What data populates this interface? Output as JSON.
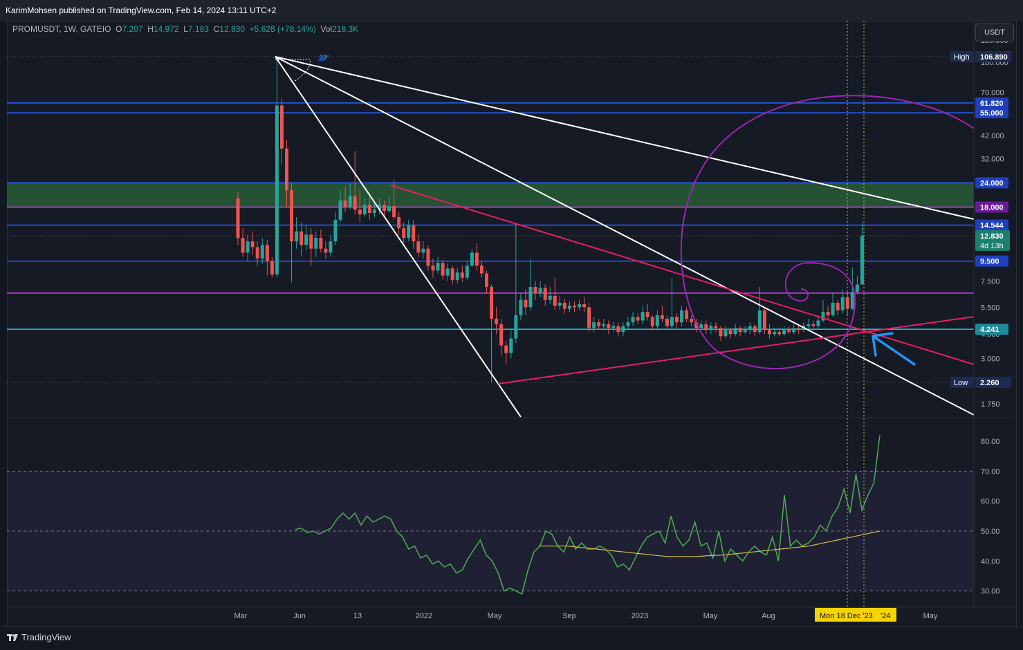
{
  "publisher": "KarimMohsen published on TradingView.com, Feb 14, 2024 13:11 UTC+2",
  "legend": {
    "symbol": "PROMUSDT, 1W, GATEIO",
    "open_label": "O",
    "open": "7.207",
    "high_label": "H",
    "high": "14.972",
    "low_label": "L",
    "low": "7.183",
    "close_label": "C",
    "close": "12.830",
    "change": "+5.628 (+78.14%)",
    "vol_label": "Vol",
    "vol": "218.3K"
  },
  "currency": "USDT",
  "footer_brand": "TradingView",
  "colors": {
    "background": "#131722",
    "up_candle": "#26a69a",
    "down_candle": "#ef5350",
    "horizontal_blue": "#2962ff",
    "magenta_level": "#e040fb",
    "cyan_level": "#26c6da",
    "pink_triangle": "#e91e63",
    "spiral": "#9c27b0",
    "rsi_line": "#4caf50",
    "rsi_ma": "#d4c04b",
    "arrow": "#2196f3",
    "cursor_line": "#c9c93a"
  },
  "chart_data": {
    "type": "candlestick",
    "scale": "log",
    "ylim": [
      1.5,
      140
    ],
    "x_ticks": [
      "Mar",
      "Jun",
      "13",
      "2022",
      "May",
      "Sep",
      "2023",
      "May",
      "Aug",
      "Dec",
      "May"
    ],
    "cursor_label": "Mon 18 Dec '23",
    "cursor_tail": "'24",
    "price_ticks": [
      "130.000",
      "100.000",
      "70.000",
      "42.000",
      "32.000",
      "7.500",
      "5.500",
      "4.000",
      "3.000",
      "1.750"
    ],
    "high_label": "High",
    "high_value": "106.890",
    "low_label": "Low",
    "low_value": "2.260",
    "levels": [
      {
        "value": 61.82,
        "label": "61.820",
        "color": "#2962ff"
      },
      {
        "value": 55.0,
        "label": "55.000",
        "color": "#2962ff"
      },
      {
        "value": 24.0,
        "label": "24.000",
        "color": "#2962ff"
      },
      {
        "value": 18.0,
        "label": "18.000",
        "color": "#e040fb"
      },
      {
        "value": 14.544,
        "label": "14.544",
        "color": "#2962ff"
      },
      {
        "value": 9.5,
        "label": "9.500",
        "color": "#2962ff"
      },
      {
        "value": 6.5,
        "label": "",
        "color": "#e040fb"
      },
      {
        "value": 4.241,
        "label": "4.241",
        "color": "#26c6da"
      }
    ],
    "last_price": "12.830",
    "countdown": "4d 13h",
    "fib_labels": [
      "23°",
      "33°"
    ],
    "candles": [
      [
        20.0,
        12.5,
        21.5,
        11.5
      ],
      [
        12.5,
        10.5,
        14.0,
        10.0
      ],
      [
        10.5,
        12.0,
        13.0,
        9.5
      ],
      [
        12.0,
        11.2,
        13.5,
        10.2
      ],
      [
        11.2,
        9.8,
        12.0,
        9.0
      ],
      [
        9.8,
        11.5,
        12.5,
        9.2
      ],
      [
        11.5,
        9.5,
        12.2,
        8.0
      ],
      [
        9.5,
        8.1,
        10.0,
        7.8
      ],
      [
        8.1,
        60.0,
        106.9,
        7.9
      ],
      [
        60.0,
        36.0,
        65.0,
        30.0
      ],
      [
        36.0,
        22.0,
        40.0,
        18.0
      ],
      [
        22.0,
        12.0,
        24.0,
        7.4
      ],
      [
        12.0,
        13.5,
        16.0,
        11.0
      ],
      [
        13.5,
        11.5,
        15.0,
        10.0
      ],
      [
        11.5,
        13.0,
        14.5,
        10.8
      ],
      [
        13.0,
        11.0,
        14.0,
        9.0
      ],
      [
        11.0,
        12.5,
        13.5,
        10.0
      ],
      [
        12.5,
        11.0,
        13.8,
        10.5
      ],
      [
        11.0,
        10.5,
        12.0,
        9.8
      ],
      [
        10.5,
        12.0,
        13.0,
        10.0
      ],
      [
        12.0,
        15.5,
        17.0,
        11.5
      ],
      [
        15.5,
        19.5,
        22.0,
        15.0
      ],
      [
        19.5,
        18.0,
        23.0,
        17.0
      ],
      [
        18.0,
        20.5,
        24.0,
        17.5
      ],
      [
        20.5,
        17.5,
        35.0,
        16.5
      ],
      [
        17.5,
        16.5,
        22.0,
        15.0
      ],
      [
        16.5,
        18.5,
        20.0,
        16.0
      ],
      [
        18.5,
        16.8,
        20.5,
        15.5
      ],
      [
        16.8,
        17.5,
        19.0,
        16.0
      ],
      [
        17.5,
        18.5,
        20.0,
        16.5
      ],
      [
        18.5,
        17.2,
        19.5,
        16.2
      ],
      [
        17.2,
        18.2,
        20.5,
        16.8
      ],
      [
        18.2,
        16.0,
        25.0,
        15.5
      ],
      [
        16.0,
        14.0,
        17.0,
        13.0
      ],
      [
        14.0,
        12.5,
        15.0,
        11.8
      ],
      [
        12.5,
        14.5,
        15.5,
        12.0
      ],
      [
        14.5,
        12.0,
        15.5,
        11.0
      ],
      [
        12.0,
        10.5,
        13.0,
        10.0
      ],
      [
        10.5,
        11.0,
        12.0,
        9.8
      ],
      [
        11.0,
        9.0,
        11.5,
        8.5
      ],
      [
        9.0,
        8.5,
        9.8,
        7.8
      ],
      [
        8.5,
        9.3,
        10.0,
        8.2
      ],
      [
        9.3,
        8.0,
        9.6,
        7.6
      ],
      [
        8.0,
        8.7,
        9.2,
        7.5
      ],
      [
        8.7,
        7.6,
        9.0,
        7.2
      ],
      [
        7.6,
        8.3,
        8.8,
        7.3
      ],
      [
        8.3,
        7.8,
        9.0,
        7.4
      ],
      [
        7.8,
        9.0,
        9.5,
        7.6
      ],
      [
        9.0,
        10.5,
        11.0,
        8.8
      ],
      [
        10.5,
        9.0,
        11.8,
        8.5
      ],
      [
        9.0,
        8.2,
        9.5,
        7.8
      ],
      [
        8.2,
        7.0,
        8.5,
        6.5
      ],
      [
        7.0,
        4.8,
        7.2,
        2.26
      ],
      [
        4.8,
        4.5,
        5.5,
        4.0
      ],
      [
        4.5,
        3.5,
        4.8,
        3.1
      ],
      [
        3.5,
        3.2,
        3.7,
        2.8
      ],
      [
        3.2,
        3.8,
        4.2,
        3.0
      ],
      [
        3.8,
        5.0,
        14.5,
        3.6
      ],
      [
        5.0,
        6.0,
        6.5,
        4.7
      ],
      [
        6.0,
        5.5,
        6.8,
        5.0
      ],
      [
        5.5,
        7.0,
        9.7,
        5.3
      ],
      [
        7.0,
        6.5,
        7.5,
        6.0
      ],
      [
        6.5,
        6.9,
        7.5,
        6.2
      ],
      [
        6.9,
        6.0,
        7.2,
        5.6
      ],
      [
        6.0,
        6.3,
        7.0,
        5.7
      ],
      [
        6.3,
        5.6,
        7.8,
        5.3
      ],
      [
        5.6,
        5.8,
        6.3,
        5.3
      ],
      [
        5.8,
        5.4,
        6.1,
        5.1
      ],
      [
        5.4,
        5.6,
        5.9,
        5.2
      ],
      [
        5.6,
        5.5,
        5.9,
        5.2
      ],
      [
        5.5,
        5.7,
        6.0,
        5.3
      ],
      [
        5.7,
        5.5,
        6.2,
        5.2
      ],
      [
        5.5,
        4.3,
        5.8,
        4.1
      ],
      [
        4.3,
        4.6,
        4.9,
        4.1
      ],
      [
        4.6,
        4.4,
        4.8,
        4.2
      ],
      [
        4.4,
        4.5,
        4.8,
        4.2
      ],
      [
        4.5,
        4.3,
        4.7,
        4.0
      ],
      [
        4.3,
        4.4,
        4.6,
        4.1
      ],
      [
        4.4,
        4.1,
        4.6,
        3.9
      ],
      [
        4.1,
        4.4,
        4.6,
        3.9
      ],
      [
        4.4,
        4.6,
        4.9,
        4.2
      ],
      [
        4.6,
        4.9,
        5.2,
        4.4
      ],
      [
        4.9,
        4.7,
        5.1,
        4.5
      ],
      [
        4.7,
        5.2,
        5.6,
        4.5
      ],
      [
        5.2,
        4.9,
        5.7,
        4.7
      ],
      [
        4.9,
        4.4,
        5.0,
        4.2
      ],
      [
        4.4,
        5.0,
        5.3,
        4.2
      ],
      [
        5.0,
        4.8,
        5.6,
        4.6
      ],
      [
        4.8,
        4.4,
        5.0,
        4.2
      ],
      [
        4.4,
        4.9,
        7.8,
        4.2
      ],
      [
        4.9,
        4.6,
        5.1,
        4.3
      ],
      [
        4.6,
        5.3,
        5.6,
        4.4
      ],
      [
        5.3,
        4.8,
        5.5,
        4.6
      ],
      [
        4.8,
        4.6,
        5.0,
        4.4
      ],
      [
        4.6,
        4.3,
        4.8,
        4.1
      ],
      [
        4.3,
        4.5,
        4.7,
        4.2
      ],
      [
        4.5,
        4.2,
        4.7,
        4.0
      ],
      [
        4.2,
        4.4,
        4.6,
        4.0
      ],
      [
        4.4,
        4.3,
        4.6,
        4.1
      ],
      [
        4.3,
        3.9,
        4.4,
        3.7
      ],
      [
        3.9,
        4.2,
        4.4,
        3.8
      ],
      [
        4.2,
        4.0,
        4.3,
        3.8
      ],
      [
        4.0,
        4.3,
        4.5,
        3.9
      ],
      [
        4.3,
        4.1,
        4.4,
        3.9
      ],
      [
        4.1,
        4.2,
        4.4,
        4.0
      ],
      [
        4.2,
        4.4,
        4.6,
        4.0
      ],
      [
        4.4,
        4.1,
        4.5,
        3.9
      ],
      [
        4.1,
        5.3,
        7.0,
        4.0
      ],
      [
        5.3,
        4.2,
        5.5,
        4.0
      ],
      [
        4.2,
        4.0,
        4.5,
        3.8
      ],
      [
        4.0,
        4.1,
        4.3,
        3.9
      ],
      [
        4.1,
        4.0,
        4.3,
        3.9
      ],
      [
        4.0,
        4.2,
        4.4,
        3.9
      ],
      [
        4.2,
        4.1,
        4.4,
        4.0
      ],
      [
        4.1,
        4.3,
        4.5,
        4.0
      ],
      [
        4.3,
        4.2,
        4.5,
        4.0
      ],
      [
        4.2,
        4.4,
        4.6,
        4.1
      ],
      [
        4.4,
        4.5,
        4.8,
        4.2
      ],
      [
        4.5,
        4.4,
        4.7,
        4.2
      ],
      [
        4.4,
        4.7,
        5.0,
        4.3
      ],
      [
        4.7,
        5.2,
        6.0,
        4.6
      ],
      [
        5.2,
        5.0,
        5.6,
        4.8
      ],
      [
        5.0,
        5.8,
        6.5,
        4.9
      ],
      [
        5.8,
        5.3,
        6.0,
        5.0
      ],
      [
        5.3,
        6.2,
        6.8,
        5.1
      ],
      [
        6.2,
        5.4,
        6.6,
        5.0
      ],
      [
        5.4,
        6.6,
        8.8,
        5.3
      ],
      [
        6.6,
        7.2,
        8.0,
        6.4
      ],
      [
        7.2,
        12.83,
        14.972,
        7.183
      ]
    ],
    "rsi": {
      "ylim": [
        26,
        86
      ],
      "ticks": [
        "80.00",
        "70.00",
        "60.00",
        "50.00",
        "40.00",
        "30.00"
      ],
      "levels": [
        70,
        50,
        30
      ],
      "values": [
        50.5,
        51,
        49.5,
        50,
        49,
        50,
        51,
        54,
        56,
        54,
        56,
        52,
        55,
        53,
        54,
        55,
        54,
        50,
        48,
        44,
        45,
        41,
        42,
        39,
        40,
        38,
        39,
        36,
        37,
        41,
        44,
        47,
        42,
        40,
        36,
        30,
        31,
        30,
        29,
        37,
        43,
        45,
        50,
        49,
        45,
        43,
        48,
        44,
        46,
        44,
        44,
        45,
        44,
        42,
        38,
        39,
        37,
        41,
        45,
        48,
        49,
        50,
        46,
        55,
        48,
        45,
        47,
        53,
        45,
        46,
        41,
        50,
        40,
        44,
        42,
        40,
        43,
        45,
        43,
        42,
        48,
        40,
        62,
        45,
        47,
        45,
        46,
        48,
        52,
        50,
        55,
        58,
        64,
        56,
        69,
        57,
        62,
        66,
        82
      ],
      "ma": [
        45,
        45,
        45,
        44.5,
        44,
        43.5,
        43,
        42.5,
        42,
        41.5,
        41.5,
        41.5,
        41.8,
        42,
        42.5,
        43,
        43.5,
        44,
        44.5,
        45,
        46,
        47,
        48,
        49,
        50
      ]
    }
  }
}
